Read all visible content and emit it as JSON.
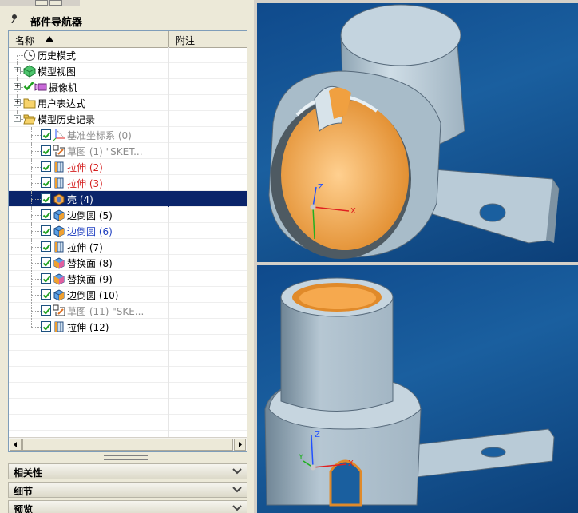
{
  "navigator": {
    "title": "部件导航器",
    "columns": {
      "name": "名称",
      "note": "附注"
    },
    "rows": [
      {
        "label": "历史模式",
        "color": "#000000",
        "icon": "clock-icon",
        "expander": "",
        "check": false
      },
      {
        "label": "模型视图",
        "color": "#000000",
        "icon": "model-views-icon",
        "expander": "+",
        "check": false
      },
      {
        "label": "摄像机",
        "color": "#000000",
        "icon": "cameras-icon",
        "expander": "+",
        "check": true
      },
      {
        "label": "用户表达式",
        "color": "#000000",
        "icon": "folder-icon",
        "expander": "+",
        "check": false
      },
      {
        "label": "模型历史记录",
        "color": "#000000",
        "icon": "open-folder-icon",
        "expander": "-",
        "check": false
      },
      {
        "label": "基准坐标系 (0)",
        "color": "#8c8c8c",
        "icon": "datum-csys-icon",
        "expander": "",
        "check": true
      },
      {
        "label": "草图 (1) \"SKET...",
        "color": "#8c8c8c",
        "icon": "sketch-icon",
        "expander": "",
        "check": true
      },
      {
        "label": "拉伸 (2)",
        "color": "#d42020",
        "icon": "extrude-icon",
        "expander": "",
        "check": true
      },
      {
        "label": "拉伸 (3)",
        "color": "#d42020",
        "icon": "extrude-icon",
        "expander": "",
        "check": true
      },
      {
        "label": "壳 (4)",
        "color": "#ffffff",
        "icon": "shell-icon",
        "expander": "",
        "check": true,
        "selected": true
      },
      {
        "label": "边倒圆 (5)",
        "color": "#000000",
        "icon": "edge-blend-icon",
        "expander": "",
        "check": true
      },
      {
        "label": "边倒圆 (6)",
        "color": "#2040c0",
        "icon": "edge-blend-icon",
        "expander": "",
        "check": true
      },
      {
        "label": "拉伸 (7)",
        "color": "#000000",
        "icon": "extrude-icon",
        "expander": "",
        "check": true
      },
      {
        "label": "替换面 (8)",
        "color": "#000000",
        "icon": "replace-face-icon",
        "expander": "",
        "check": true
      },
      {
        "label": "替换面 (9)",
        "color": "#000000",
        "icon": "replace-face-icon",
        "expander": "",
        "check": true
      },
      {
        "label": "边倒圆 (10)",
        "color": "#000000",
        "icon": "edge-blend-icon",
        "expander": "",
        "check": true
      },
      {
        "label": "草图 (11) \"SKE...",
        "color": "#8c8c8c",
        "icon": "sketch-icon",
        "expander": "",
        "check": true
      },
      {
        "label": "拉伸 (12)",
        "color": "#000000",
        "icon": "extrude-icon",
        "expander": "",
        "check": true
      }
    ]
  },
  "sections": [
    {
      "label": "相关性"
    },
    {
      "label": "细节"
    },
    {
      "label": "预览"
    }
  ],
  "viewport": {
    "axis_x": "X",
    "axis_y": "Y",
    "axis_z": "Z"
  },
  "colors": {
    "background_blue": "#1a5f9f",
    "part_gray": "#a9bcc9",
    "inner_orange": "#f4a94a",
    "selection": "#0a246a"
  }
}
